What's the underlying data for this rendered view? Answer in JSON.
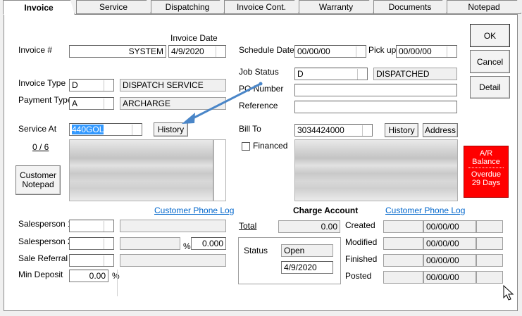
{
  "tabs": [
    "Invoice",
    "Service",
    "Dispatching",
    "Invoice Cont.",
    "Warranty",
    "Documents",
    "Notepad"
  ],
  "invoice": {
    "number_label": "Invoice #",
    "number_value": "SYSTEM",
    "date_label": "Invoice Date",
    "date_value": "4/9/2020",
    "type_label": "Invoice Type",
    "type_code": "D",
    "type_desc": "DISPATCH SERVICE",
    "payment_label": "Payment Type",
    "payment_code": "A",
    "payment_desc": "ARCHARGE"
  },
  "service": {
    "label": "Service At",
    "value": "440GOL",
    "history_btn": "History",
    "count": "0 / 6",
    "notepad_btn": "Customer Notepad",
    "phone_log": "Customer Phone Log"
  },
  "schedule": {
    "schedule_label": "Schedule Date",
    "schedule_value": "00/00/00",
    "pickup_label": "Pick up",
    "pickup_value": "00/00/00",
    "job_status_label": "Job Status",
    "job_status_code": "D",
    "job_status_desc": "DISPATCHED",
    "po_label": "PO Number",
    "po_value": "",
    "reference_label": "Reference",
    "reference_value": ""
  },
  "billto": {
    "label": "Bill To",
    "value": "3034424000",
    "history_btn": "History",
    "address_btn": "Address",
    "financed_label": "Financed",
    "phone_log": "Customer Phone Log"
  },
  "buttons": {
    "ok": "OK",
    "cancel": "Cancel",
    "detail": "Detail"
  },
  "ar_box": {
    "line1": "A/R",
    "line2": "Balance",
    "line3": "Overdue",
    "line4": "29 Days"
  },
  "sales": {
    "sp1_label": "Salesperson 1",
    "sp2_label": "Salesperson 2",
    "percent_sign": "%",
    "sp2_percent": "0.000",
    "referral_label": "Sale Referral",
    "min_deposit_label": "Min Deposit",
    "min_deposit_value": "0.00",
    "min_deposit_pct": "%"
  },
  "charge": {
    "title": "Charge Account",
    "total_label": "Total",
    "total_value": "0.00",
    "status_label": "Status",
    "status_value": "Open",
    "status_date": "4/9/2020",
    "created_label": "Created",
    "created_date": "00/00/00",
    "modified_label": "Modified",
    "modified_date": "00/00/00",
    "finished_label": "Finished",
    "finished_date": "00/00/00",
    "posted_label": "Posted",
    "posted_date": "00/00/00"
  },
  "colors": {
    "ar_red": "#ff0000",
    "link_blue": "#0066cc",
    "selection_blue": "#3399ff",
    "arrow_blue": "#4a86c8"
  }
}
